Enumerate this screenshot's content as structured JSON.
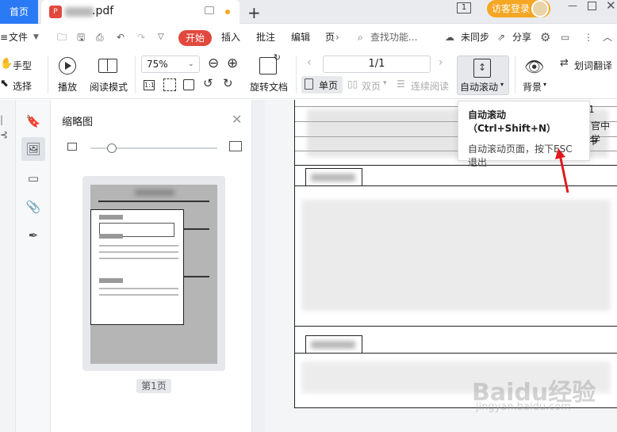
{
  "tabbar": {
    "home_label": "首页",
    "doc_tab_label": ".pdf",
    "pdf_badge": "P",
    "new_tab": "+",
    "page_counter": "1",
    "login_label": "访客登录"
  },
  "menu": {
    "file": "文件",
    "start": "开始",
    "insert": "插入",
    "annotate": "批注",
    "edit": "编辑",
    "page": "页",
    "search_placeholder": "查找功能...",
    "sync": "未同步",
    "share": "分享"
  },
  "toolbar": {
    "hand": "手型",
    "select": "选择",
    "play": "播放",
    "read_mode": "阅读模式",
    "zoom": "75%",
    "rotate": "旋转文档",
    "page_value": "1/1",
    "single_page": "单页",
    "double_page": "双页",
    "continuous": "连续阅读",
    "auto_scroll": "自动滚动",
    "background": "背景",
    "translate": "划词翻译"
  },
  "thumbnail_panel": {
    "title": "缩略图",
    "page_label": "第1页"
  },
  "tooltip": {
    "title": "自动滚动（Ctrl+Shift+N）",
    "description": "自动滚动页面，按下ESC退出"
  },
  "document": {
    "text_fragment_1": "官中学",
    "text_fragment_2": "中",
    "text_fragment_3": "1"
  },
  "watermark": {
    "text": "Baidu经验",
    "sub": "jingyan.baidu.com"
  },
  "colors": {
    "accent_blue": "#2a7af5",
    "start_red": "#e2483d",
    "login_orange": "#f5a623",
    "annotation_arrow": "#e0191f"
  }
}
